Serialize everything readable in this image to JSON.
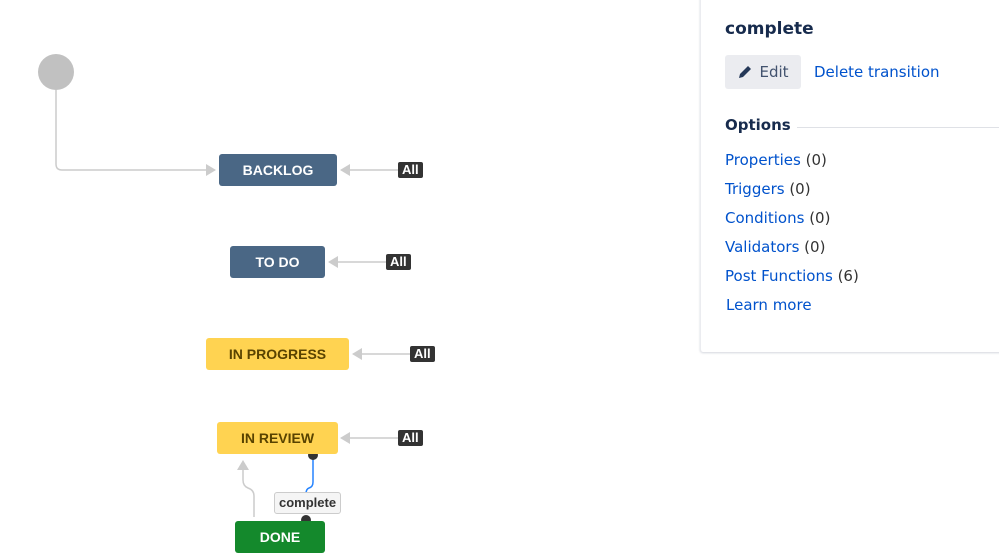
{
  "diagram": {
    "statuses": [
      {
        "label": "BACKLOG",
        "category_color": "#4a6785"
      },
      {
        "label": "TO DO",
        "category_color": "#4a6785"
      },
      {
        "label": "IN PROGRESS",
        "category_color": "#ffd351"
      },
      {
        "label": "IN REVIEW",
        "category_color": "#ffd351"
      },
      {
        "label": "DONE",
        "category_color": "#14892c"
      }
    ],
    "global_transition_label": "All",
    "selected_transition_label": "complete",
    "selected_transition_color": "#2684ff"
  },
  "panel": {
    "title": "complete",
    "edit_label": "Edit",
    "edit_icon": "pencil-icon",
    "delete_label": "Delete transition",
    "options_heading": "Options",
    "options": [
      {
        "label": "Properties",
        "count": "(0)"
      },
      {
        "label": "Triggers",
        "count": "(0)"
      },
      {
        "label": "Conditions",
        "count": "(0)"
      },
      {
        "label": "Validators",
        "count": "(0)"
      },
      {
        "label": "Post Functions",
        "count": "(6)"
      }
    ],
    "learn_more": "Learn more"
  }
}
